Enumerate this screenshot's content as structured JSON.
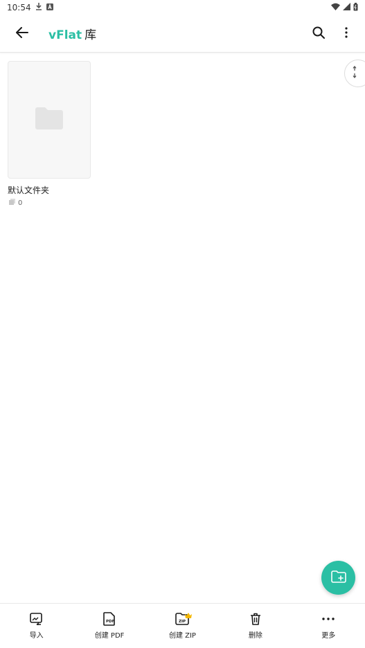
{
  "status_bar": {
    "time": "10:54"
  },
  "header": {
    "brand": "vFlat",
    "title_suffix": "库"
  },
  "folders": [
    {
      "name": "默认文件夹",
      "count": "0"
    }
  ],
  "bottom_nav": [
    {
      "label": "导入",
      "icon": "import-icon"
    },
    {
      "label": "创建 PDF",
      "icon": "pdf-icon"
    },
    {
      "label": "创建 ZIP",
      "icon": "zip-icon"
    },
    {
      "label": "删除",
      "icon": "trash-icon"
    },
    {
      "label": "更多",
      "icon": "more-horizontal-icon"
    }
  ],
  "colors": {
    "accent": "#2bbfa4",
    "crown": "#f5b800"
  }
}
